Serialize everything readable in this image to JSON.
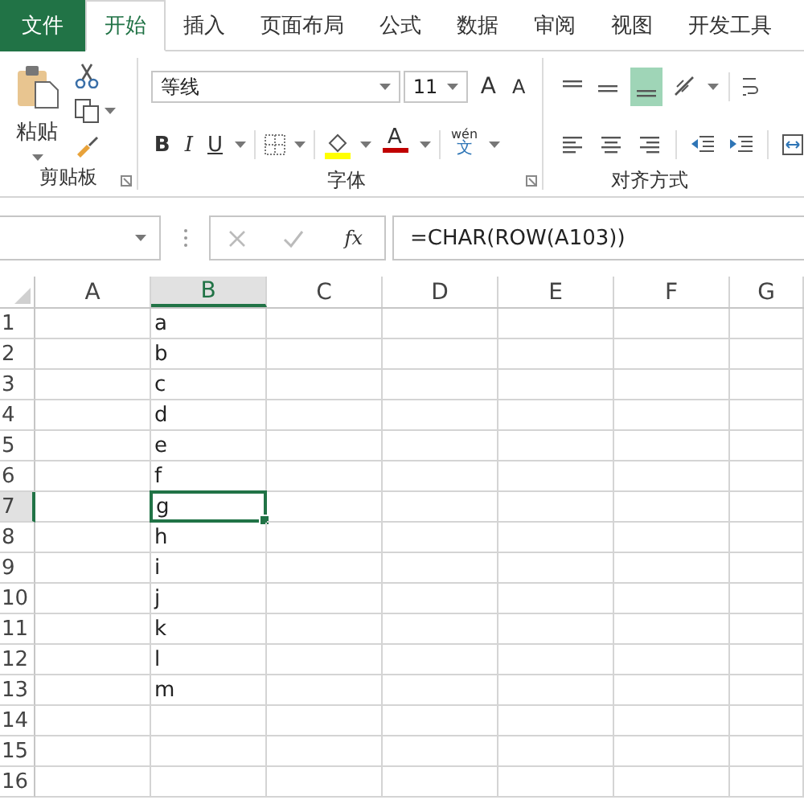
{
  "tabs": [
    {
      "label": "文件",
      "kind": "file",
      "selected": false
    },
    {
      "label": "开始",
      "kind": "tab",
      "selected": true
    },
    {
      "label": "插入",
      "kind": "tab",
      "selected": false
    },
    {
      "label": "页面布局",
      "kind": "tab",
      "selected": false
    },
    {
      "label": "公式",
      "kind": "tab",
      "selected": false
    },
    {
      "label": "数据",
      "kind": "tab",
      "selected": false
    },
    {
      "label": "审阅",
      "kind": "tab",
      "selected": false
    },
    {
      "label": "视图",
      "kind": "tab",
      "selected": false
    },
    {
      "label": "开发工具",
      "kind": "tab",
      "selected": false
    }
  ],
  "ribbon": {
    "clipboard": {
      "paste_label": "粘贴",
      "group_label": "剪贴板"
    },
    "font": {
      "font_name": "等线",
      "font_size": "11",
      "grow": "A",
      "shrink": "A",
      "bold": "B",
      "italic": "I",
      "underline": "U",
      "font_color": "A",
      "phonetic_top": "wén",
      "phonetic_bottom": "文",
      "group_label": "字体"
    },
    "alignment": {
      "bottom_align_selected": true,
      "group_label": "对齐方式"
    }
  },
  "formula_bar": {
    "fx": "fx",
    "formula": "=CHAR(ROW(A103))"
  },
  "columns": [
    {
      "label": "A",
      "selected": false
    },
    {
      "label": "B",
      "selected": true
    },
    {
      "label": "C",
      "selected": false
    },
    {
      "label": "D",
      "selected": false
    },
    {
      "label": "E",
      "selected": false
    },
    {
      "label": "F",
      "selected": false
    },
    {
      "label": "G",
      "selected": false
    }
  ],
  "rows": [
    {
      "number": "1",
      "b": "a",
      "selected": false
    },
    {
      "number": "2",
      "b": "b",
      "selected": false
    },
    {
      "number": "3",
      "b": "c",
      "selected": false
    },
    {
      "number": "4",
      "b": "d",
      "selected": false
    },
    {
      "number": "5",
      "b": "e",
      "selected": false
    },
    {
      "number": "6",
      "b": "f",
      "selected": false
    },
    {
      "number": "7",
      "b": "g",
      "selected": true
    },
    {
      "number": "8",
      "b": "h",
      "selected": false
    },
    {
      "number": "9",
      "b": "i",
      "selected": false
    },
    {
      "number": "10",
      "b": "j",
      "selected": false
    },
    {
      "number": "11",
      "b": "k",
      "selected": false
    },
    {
      "number": "12",
      "b": "l",
      "selected": false
    },
    {
      "number": "13",
      "b": "m",
      "selected": false
    },
    {
      "number": "14",
      "selected": false
    },
    {
      "number": "15",
      "selected": false
    },
    {
      "number": "16",
      "selected": false
    }
  ]
}
